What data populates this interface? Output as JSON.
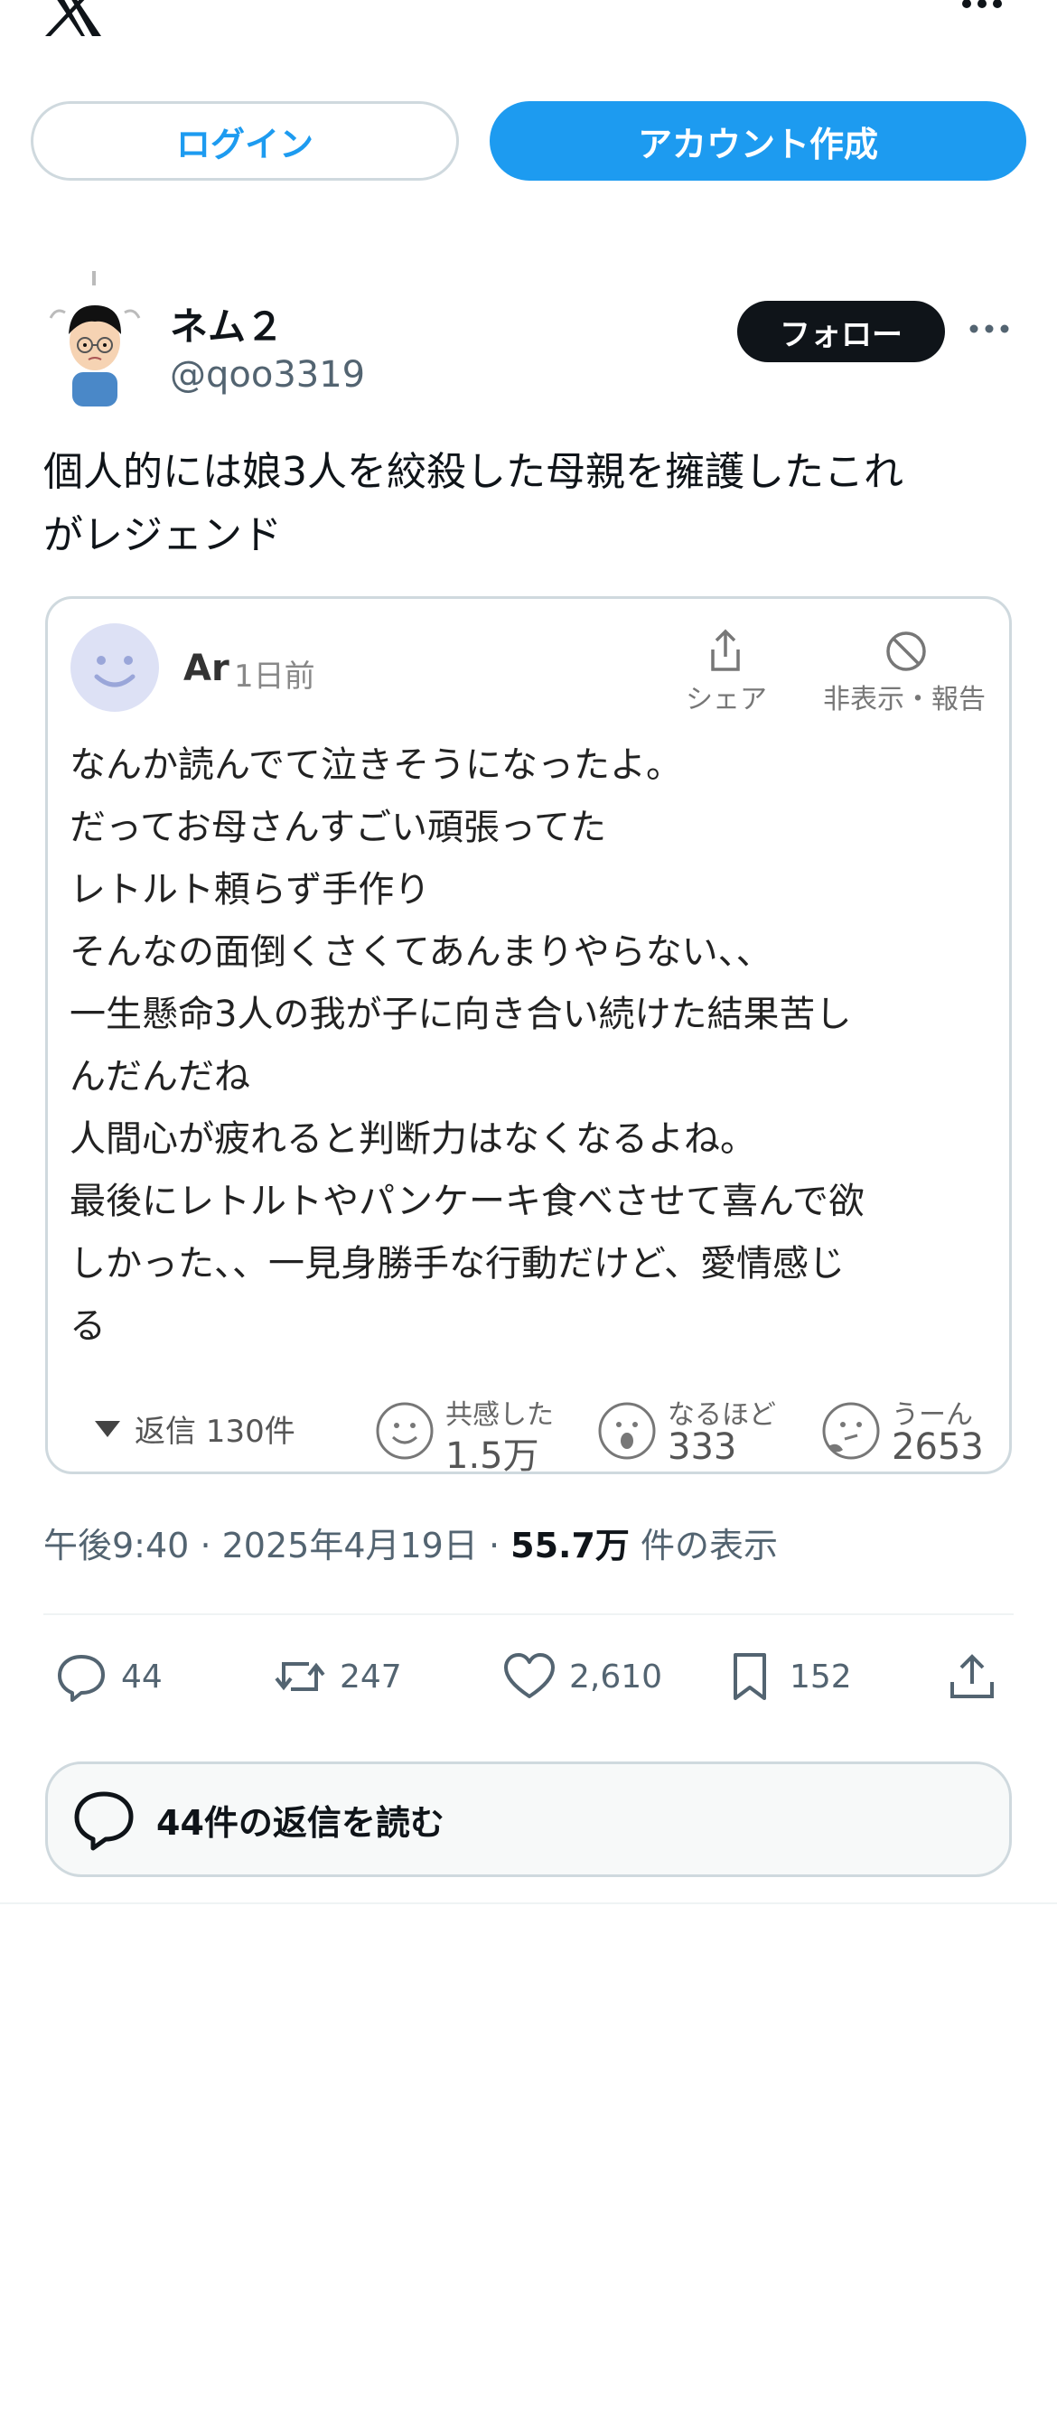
{
  "topbar": {
    "logo": "x-logo-icon",
    "more": "more-horizontal-icon"
  },
  "auth": {
    "login_label": "ログイン",
    "signup_label": "アカウント作成",
    "accent": "#1d9bf0"
  },
  "post": {
    "author_name": "ネム２",
    "handle": "@qoo3319",
    "follow_label": "フォロー",
    "text_lines": [
      "個人的には娘3人を絞殺した母親を擁護したこれ",
      "がレジェンド"
    ]
  },
  "quote": {
    "user_name": "Ar",
    "time": "1日前",
    "share_label": "シェア",
    "hide_label": "非表示・報告",
    "body_lines": [
      "なんか読んでて泣きそうになったよ。",
      "だってお母さんすごい頑張ってた",
      "レトルト頼らず手作り",
      "そんなの面倒くさくてあんまりやらない、、",
      "一生懸命3人の我が子に向き合い続けた結果苦し",
      "んだんだね",
      "人間心が疲れると判断力はなくなるよね。",
      "最後にレトルトやパンケーキ食べさせて喜んで欲",
      "しかった、、一見身勝手な行動だけど、愛情感じ",
      "る"
    ],
    "replies_label": "返信 130件",
    "reactions": [
      {
        "label": "共感した",
        "value": "1.5万"
      },
      {
        "label": "なるほど",
        "value": "333"
      },
      {
        "label": "うーん",
        "value": "2653"
      }
    ]
  },
  "meta": {
    "time": "午後9:40",
    "sep": "·",
    "date": "2025年4月19日",
    "views_num": "55.7万",
    "views_label": "件の表示"
  },
  "actions": {
    "replies": "44",
    "reposts": "247",
    "likes": "2,610",
    "bookmarks": "152"
  },
  "read_replies_label": "44件の返信を読む"
}
